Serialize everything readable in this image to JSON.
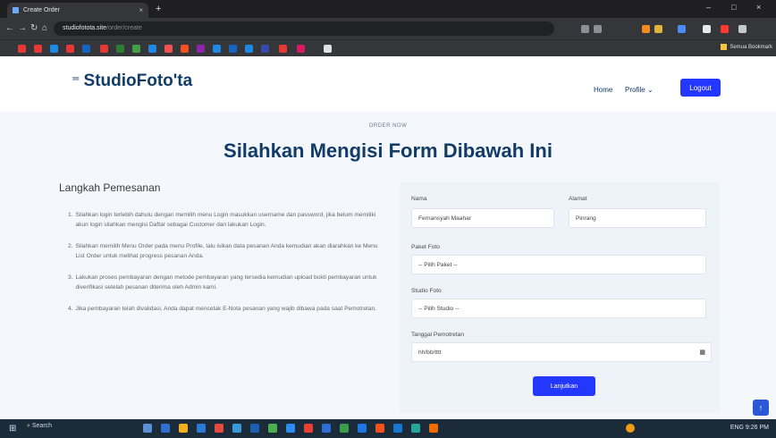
{
  "browser": {
    "tab_title": "Create Order",
    "tab_close": "×",
    "new_tab": "+",
    "url_host": "studiofotota.site",
    "url_path": "/order/create",
    "win_min": "–",
    "win_max": "□",
    "win_close": "×",
    "all_bookmarks": "Semua Bookmark"
  },
  "navbar": {
    "brand": "StudioFoto'ta",
    "brand_icon": "menu-lines",
    "home": "Home",
    "profile": "Profile",
    "logout": "Logout"
  },
  "page": {
    "eyebrow": "ORDER NOW",
    "heading": "Silahkan Mengisi Form Dibawah Ini"
  },
  "steps": {
    "title": "Langkah Pemesanan",
    "items": [
      {
        "n": "1.",
        "text": "Silahkan login terlebih dahulu dengan memilih menu Login masukkan username dan password, jika belum memiliki akun login silahkan mengisi Daftar sebagai Customer dan lakukan Login."
      },
      {
        "n": "2.",
        "text": "Silahkan memilih Menu Order pada menu Profile, lalu isikan data pesanan Anda kemudian akan diarahkan ke Menu List Order untuk melihat progress pesanan Anda."
      },
      {
        "n": "3.",
        "text": "Lakukan proses pembayaran dengan metode pembayaran yang tersedia kemudian upload bukti pembayaran untuk diverifikasi setelah pesanan diterima oleh Admin kami."
      },
      {
        "n": "4.",
        "text": "Jika pembayaran telah divalidasi, Anda dapat mencetak E-Nota pesanan yang wajib dibawa pada saat Pemotretan."
      }
    ]
  },
  "form": {
    "nama_label": "Nama",
    "nama_value": "Fernansyah Maahar",
    "alamat_label": "Alamat",
    "alamat_value": "Pinrang",
    "paket_label": "Paket Foto",
    "paket_value": "-- Pilih Paket --",
    "studio_label": "Studio Foto",
    "studio_value": "-- Pilih Studio --",
    "tanggal_label": "Tanggal Pemotretan",
    "tanggal_value": "hh/bb/tttt",
    "submit": "Lanjutkan"
  },
  "taskbar": {
    "search": "Search",
    "tray": "ENG 9:26 PM"
  },
  "colors": {
    "brand_blue": "#123c68",
    "accent": "#2437ff",
    "section_bg": "#f4f7fc"
  }
}
